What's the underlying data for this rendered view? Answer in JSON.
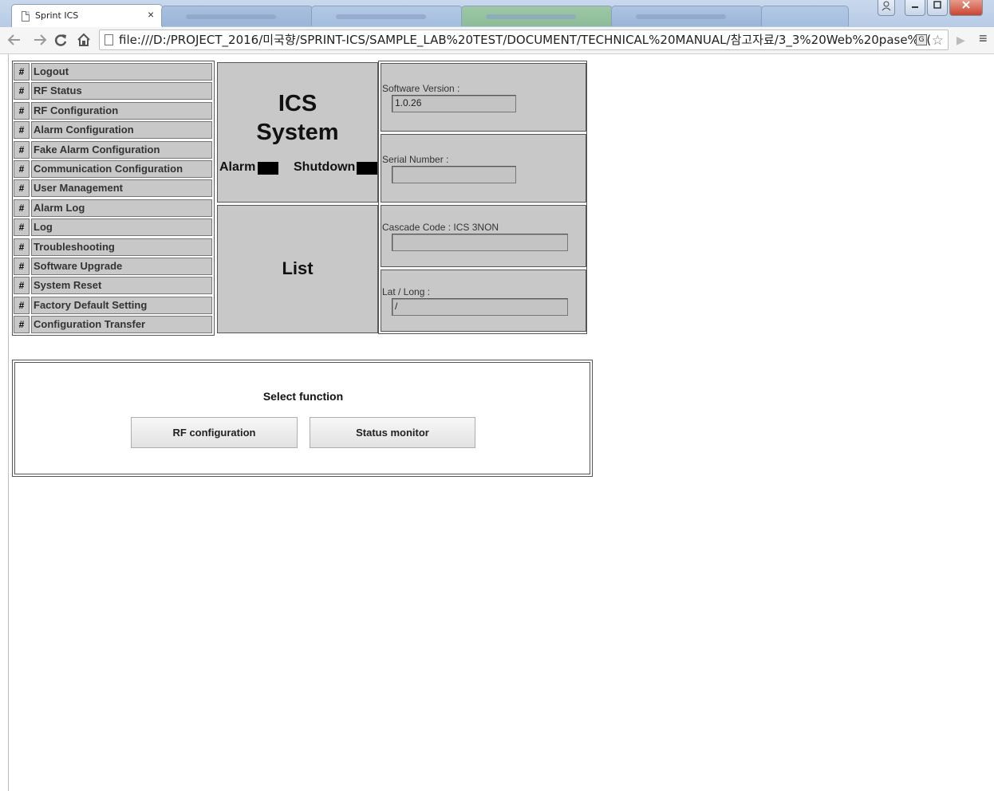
{
  "browser": {
    "tab_title": "Sprint ICS",
    "tab_close": "×",
    "address_url": "file:///D:/PROJECT_2016/미국향/SPRINT-ICS/SAMPLE_LAB%20TEST/DOCUMENT/TECHNICAL%20MANUAL/참고자료/3_3%20Web%20pase%2(",
    "window_buttons": [
      "minimize",
      "maximize",
      "close"
    ],
    "icons": [
      "page-icon",
      "back-arrow-icon",
      "forward-arrow-icon",
      "reload-icon",
      "home-icon",
      "translate-icon",
      "star-icon",
      "extension-icon",
      "menu-icon"
    ]
  },
  "sidebar": {
    "hash": "#",
    "items": [
      {
        "label": "Logout"
      },
      {
        "label": "RF Status"
      },
      {
        "label": "RF Configuration"
      },
      {
        "label": "Alarm Configuration"
      },
      {
        "label": "Fake Alarm Configuration"
      },
      {
        "label": "Communication Configuration"
      },
      {
        "label": "User Management"
      },
      {
        "label": "Alarm Log"
      },
      {
        "label": "Log"
      },
      {
        "label": "Troubleshooting"
      },
      {
        "label": "Software Upgrade"
      },
      {
        "label": "System Reset"
      },
      {
        "label": "Factory Default Setting"
      },
      {
        "label": "Configuration Transfer"
      }
    ]
  },
  "system": {
    "title_line1": "ICS",
    "title_line2": "System",
    "alarm_label": "Alarm",
    "shutdown_label": "Shutdown",
    "list_label": "List"
  },
  "info": {
    "software_version_label": "Software Version :",
    "software_version_value": "1.0.26",
    "serial_number_label": "Serial Number :",
    "serial_number_value": "",
    "cascade_code_label": "Cascade Code : ICS 3NON",
    "cascade_code_value": "",
    "lat_long_label": "Lat / Long :",
    "lat_long_value": "/"
  },
  "function": {
    "title": "Select function",
    "rf_button": "RF configuration",
    "status_button": "Status monitor"
  },
  "colors": {
    "panel_gray": "#c8c8c8",
    "indicator": "#000000",
    "titlebar": "#b7cbe6"
  }
}
